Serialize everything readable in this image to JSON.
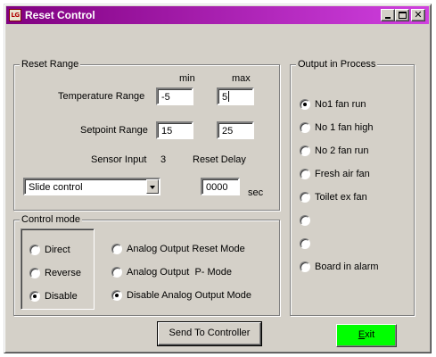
{
  "window": {
    "title": "Reset Control",
    "icon_text": "LG",
    "icon": "app-logo-icon",
    "title_gradient": [
      "#800080",
      "#d040e0"
    ],
    "caption_buttons": [
      "minimize-icon",
      "maximize-icon",
      "close-icon"
    ],
    "close_glyph": "✕"
  },
  "reset_range": {
    "legend": "Reset Range",
    "min_label": "min",
    "max_label": "max",
    "temperature_label": "Temperature Range",
    "temperature_min": "-5",
    "temperature_max": "5",
    "setpoint_label": "Setpoint Range",
    "setpoint_min": "15",
    "setpoint_max": "25",
    "sensor_input_label": "Sensor Input",
    "sensor_input_value": "3",
    "reset_delay_label": "Reset Delay",
    "sensor_select_value": "Slide control",
    "reset_delay_value": "0000",
    "reset_delay_unit": "sec"
  },
  "control_mode": {
    "legend": "Control mode",
    "options_left": [
      {
        "label": "Direct",
        "checked": false
      },
      {
        "label": "Reverse",
        "checked": false
      },
      {
        "label": "Disable",
        "checked": true
      }
    ],
    "options_right": [
      {
        "label": "Analog Output Reset Mode",
        "checked": false
      },
      {
        "label": "Analog Output  P- Mode",
        "checked": false
      },
      {
        "label": "Disable Analog Output Mode",
        "checked": true
      }
    ]
  },
  "output_in_process": {
    "legend": "Output in Process",
    "items": [
      {
        "label": "No1 fan run",
        "checked": true
      },
      {
        "label": "No 1 fan high",
        "checked": false
      },
      {
        "label": "No 2 fan run",
        "checked": false
      },
      {
        "label": "Fresh air fan",
        "checked": false
      },
      {
        "label": "Toilet ex fan",
        "checked": false
      },
      {
        "label": "",
        "checked": false
      },
      {
        "label": "",
        "checked": false
      },
      {
        "label": "Board in alarm",
        "checked": false
      }
    ]
  },
  "buttons": {
    "send_label": "Send To Controller",
    "exit_accel": "E",
    "exit_rest": "xit",
    "exit_color": "#00ff00"
  }
}
